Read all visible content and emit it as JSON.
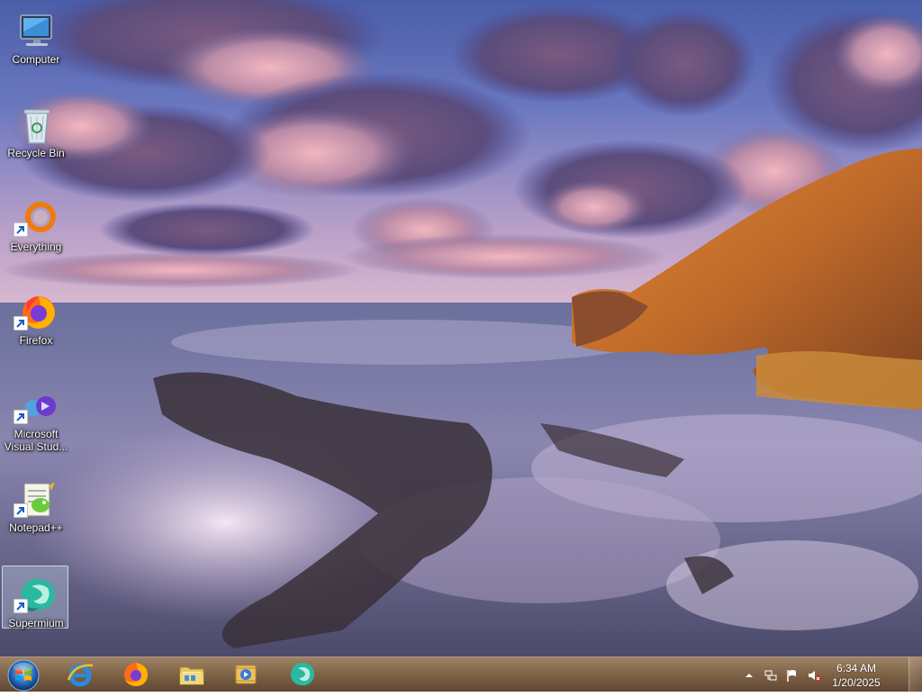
{
  "desktop": {
    "icons": [
      {
        "label": "Computer",
        "icon": "computer-icon",
        "shortcut": false
      },
      {
        "label": "Recycle Bin",
        "icon": "recycle-bin-icon",
        "shortcut": false
      },
      {
        "label": "Everything",
        "icon": "everything-icon",
        "shortcut": true
      },
      {
        "label": "Firefox",
        "icon": "firefox-icon",
        "shortcut": true
      },
      {
        "label": "Microsoft Visual Stud...",
        "icon": "visual-studio-icon",
        "shortcut": true
      },
      {
        "label": "Notepad++",
        "icon": "notepad-plus-plus-icon",
        "shortcut": true
      },
      {
        "label": "Supermium",
        "icon": "supermium-icon",
        "shortcut": true,
        "selected": true
      }
    ]
  },
  "taskbar": {
    "start": "start-orb-icon",
    "pinned": [
      {
        "name": "internet-explorer",
        "icon": "internet-explorer-icon"
      },
      {
        "name": "firefox",
        "icon": "firefox-icon"
      },
      {
        "name": "file-explorer",
        "icon": "folder-icon"
      },
      {
        "name": "media-player",
        "icon": "media-player-icon"
      },
      {
        "name": "supermium",
        "icon": "supermium-icon"
      }
    ],
    "tray": {
      "icons": [
        "show-hidden-icons-arrow",
        "network-icon",
        "action-center-flag-icon",
        "volume-muted-icon"
      ],
      "time": "6:34 AM",
      "date": "1/20/2025"
    }
  },
  "colors": {
    "taskbar": "#7a5a3c",
    "selection": "#c8dcf0"
  }
}
